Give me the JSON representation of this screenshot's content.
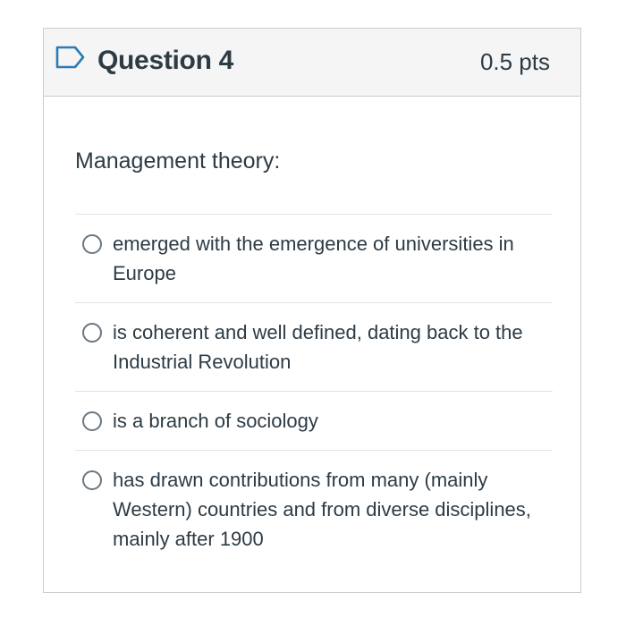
{
  "question": {
    "title": "Question 4",
    "points": "0.5 pts",
    "prompt": "Management theory:",
    "answers": [
      "emerged with the emergence of universities in Europe",
      "is coherent and well defined, dating back to the Industrial Revolution",
      "is a branch of sociology",
      "has drawn contributions from many (mainly Western) countries and from diverse disciplines, mainly after 1900"
    ]
  },
  "colors": {
    "text": "#2d3b45",
    "header_bg": "#f5f5f5",
    "border": "#c7cdd1",
    "flag_icon": "#2d7bb5"
  },
  "icons": {
    "flag": "bookmark-flag-icon"
  }
}
